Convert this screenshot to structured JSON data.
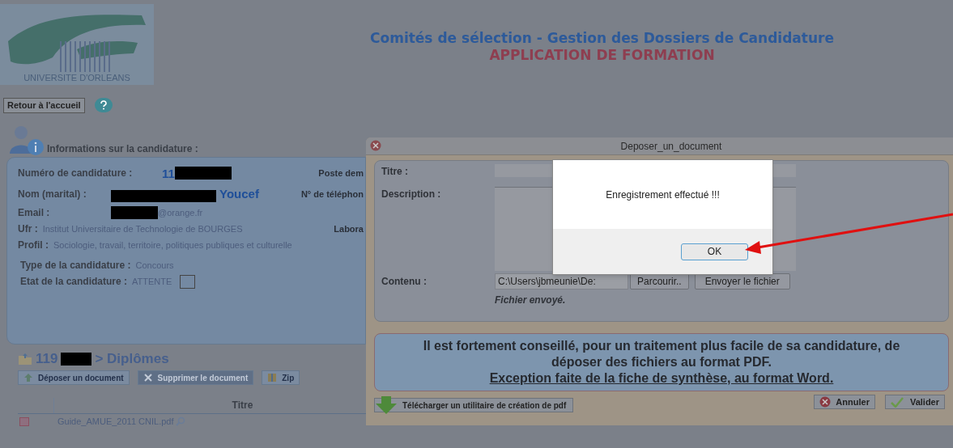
{
  "header": {
    "logo_text": "UNIVERSITE D'ORLEANS",
    "title": "Comités de sélection - Gestion des Dossiers de Candidature",
    "subtitle": "APPLICATION DE FORMATION"
  },
  "toolbar": {
    "home_button": "Retour à l'accueil"
  },
  "candidature": {
    "heading": "Informations sur la candidature :",
    "rows": [
      {
        "label": "Numéro de candidature :",
        "parts": [
          {
            "kind": "number",
            "text": "11"
          },
          {
            "kind": "redaction"
          }
        ],
        "side_label": "Poste dem"
      },
      {
        "label": "Nom (marital) :",
        "parts": [
          {
            "kind": "redaction"
          },
          {
            "kind": "name",
            "text": "Youcef"
          }
        ],
        "side_label": "N° de téléphon"
      },
      {
        "label": "Email :",
        "parts": [
          {
            "kind": "redaction"
          },
          {
            "kind": "text",
            "text": "@orange.fr"
          }
        ]
      },
      {
        "label": "Ufr :",
        "parts": [
          {
            "kind": "text",
            "text": "Institut Universitaire de Technologie de BOURGES"
          }
        ],
        "side_label": "Labora"
      },
      {
        "label": "Profil :",
        "parts": [
          {
            "kind": "text",
            "text": "Sociologie, travail, territoire, politiques publiques et culturelle"
          }
        ]
      }
    ],
    "type_label": "Type de la candidature :",
    "type_value": "Concours",
    "state_label": "Etat de la candidature :",
    "state_value": "ATTENTE",
    "state_checked": false
  },
  "diplomes": {
    "heading_number": "119",
    "heading_title": "> Diplômes",
    "buttons": [
      {
        "label": "Déposer un document",
        "disabled": false
      },
      {
        "label": "Supprimer le document",
        "disabled": true
      },
      {
        "label": "Zip",
        "disabled": false
      }
    ],
    "column": "Titre",
    "rows": [
      "Guide_AMUE_2011 CNIL.pdf"
    ]
  },
  "dialog": {
    "title": "Deposer_un_document",
    "titre_label": "Titre :",
    "description_label": "Description :",
    "contenu_label": "Contenu :",
    "file_value": "C:\\Users\\jbmeunie\\De:",
    "browse_button": "Parcourir..",
    "send_button": "Envoyer le fichier",
    "status": "Fichier envoyé.",
    "notice": "Il est fortement conseillé, pour un traitement plus facile de sa candidature, de déposer des fichiers au format PDF.",
    "notice_underlined": "Exception faite de la fiche de synthèse, au format Word.",
    "download_button": "Télécharger un utilitaire de création de pdf",
    "cancel_button": "Annuler",
    "submit_button": "Valider"
  },
  "alert": {
    "message": "Enregistrement effectué !!!",
    "ok_button": "OK"
  }
}
